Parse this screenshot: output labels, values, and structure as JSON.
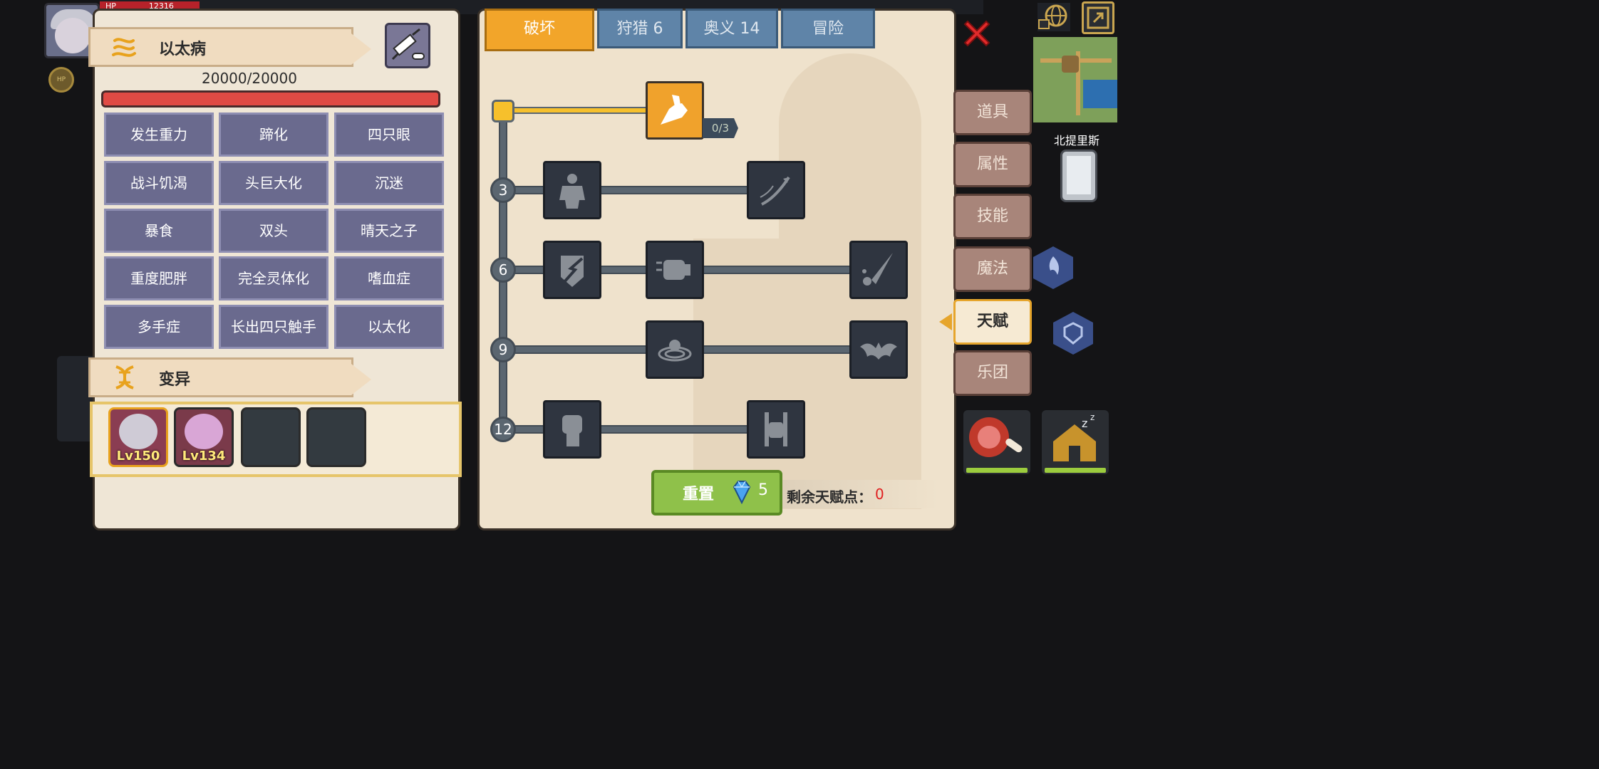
{
  "hud": {
    "hp_label": "HP",
    "hp_value": "12316",
    "coin_label": "HP"
  },
  "disease_panel": {
    "title": "以太病",
    "title_icon": "serpent-icon",
    "syringe_icon": "syringe-icon",
    "hp_text": "20000/20000",
    "hp_fraction": 1.0,
    "diseases": [
      [
        "发生重力",
        "蹄化",
        "四只眼"
      ],
      [
        "战斗饥渴",
        "头巨大化",
        "沉迷"
      ],
      [
        "暴食",
        "双头",
        "晴天之子"
      ],
      [
        "重度肥胖",
        "完全灵体化",
        "嗜血症"
      ],
      [
        "多手症",
        "长出四只触手",
        "以太化"
      ]
    ]
  },
  "mutation_panel": {
    "title": "变异",
    "title_icon": "dna-icon",
    "members": [
      {
        "level": "Lv150",
        "selected": true
      },
      {
        "level": "Lv134",
        "selected": false
      },
      {
        "level": "",
        "selected": false
      },
      {
        "level": "",
        "selected": false
      }
    ]
  },
  "talent_panel": {
    "tabs": [
      {
        "label": "破坏",
        "active": true
      },
      {
        "label": "狩猎 6",
        "active": false
      },
      {
        "label": "奥义 14",
        "active": false
      },
      {
        "label": "冒险",
        "active": false
      }
    ],
    "top_talent": {
      "icon": "arm-wrestle-icon",
      "count": "0/3"
    },
    "levels": [
      "3",
      "6",
      "9",
      "12"
    ],
    "rows": [
      {
        "level": "3",
        "icons": [
          "giant-silhouette-icon",
          "arrow-swoosh-icon"
        ]
      },
      {
        "level": "6",
        "icons": [
          "shield-break-icon",
          "fist-strike-icon",
          "blade-splash-icon"
        ]
      },
      {
        "level": "9",
        "icons": [
          "ripple-orb-icon",
          "bat-wing-icon"
        ]
      },
      {
        "level": "12",
        "icons": [
          "raised-fist-icon",
          "stone-fist-icon"
        ]
      }
    ],
    "reset_label": "重置",
    "reset_cost": "5",
    "remaining_label": "剩余天赋点：",
    "remaining_value": "0"
  },
  "side_menu": [
    {
      "label": "道具",
      "active": false
    },
    {
      "label": "属性",
      "active": false
    },
    {
      "label": "技能",
      "active": false
    },
    {
      "label": "魔法",
      "active": false
    },
    {
      "label": "天赋",
      "active": true
    },
    {
      "label": "乐团",
      "active": false
    }
  ],
  "map": {
    "region": "北提里斯"
  },
  "colors": {
    "accent": "#f2a52a",
    "tab_inactive": "#5f84a8",
    "hp_bar": "#e04a44",
    "remaining_value": "#e02020",
    "reset_button": "#8fc14a"
  }
}
